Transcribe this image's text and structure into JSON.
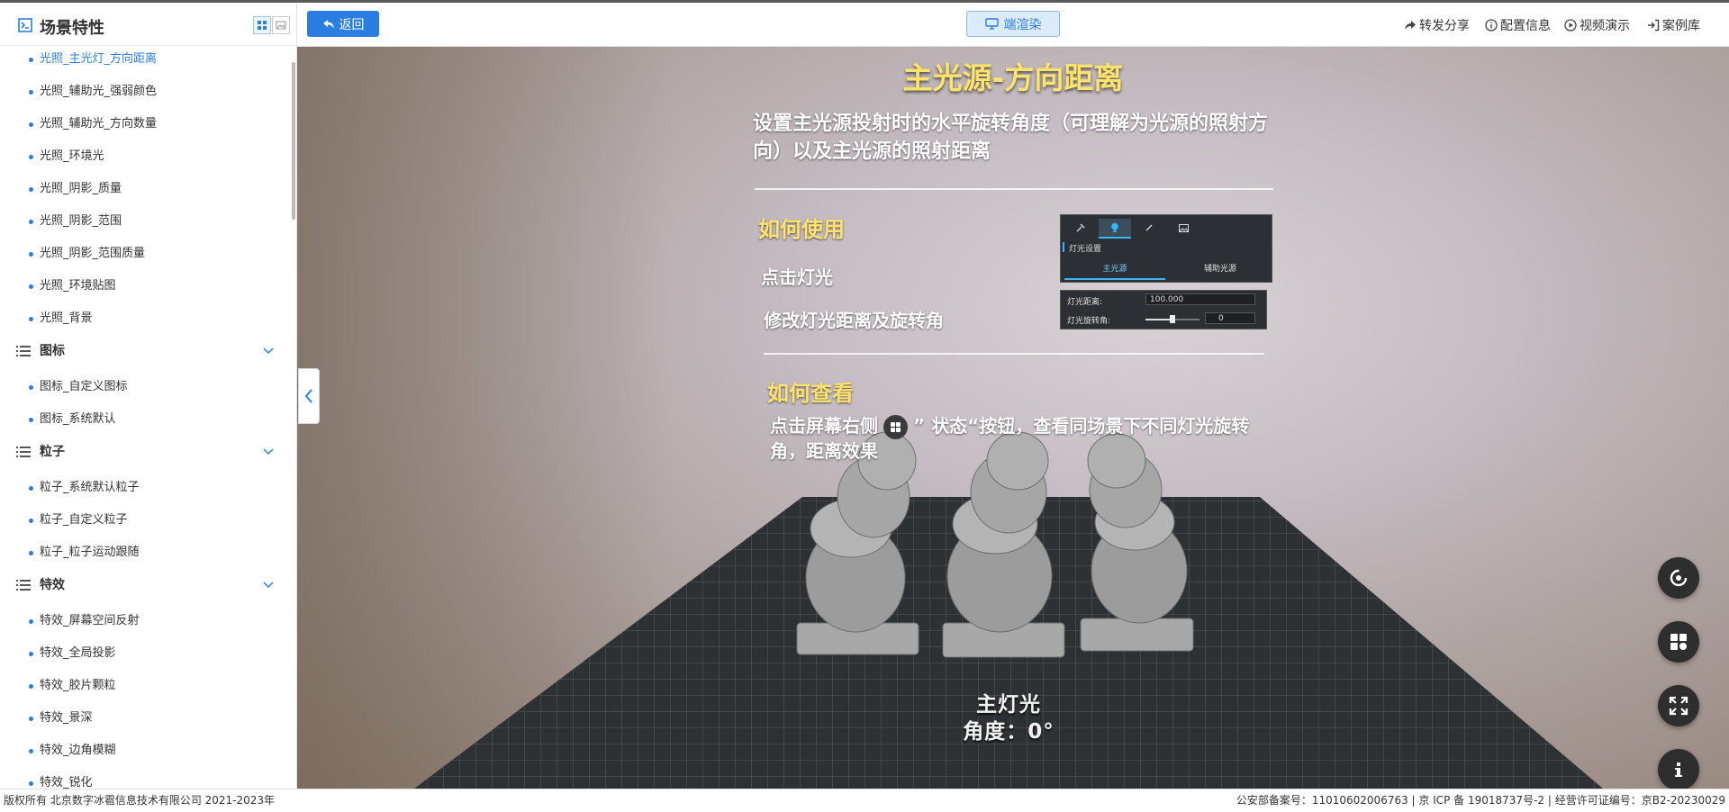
{
  "sidebar": {
    "title": "场景特性",
    "items_top": [
      {
        "label": "光照_主光灯_方向距离",
        "active": true
      },
      {
        "label": "光照_辅助光_强弱颜色"
      },
      {
        "label": "光照_辅助光_方向数量"
      },
      {
        "label": "光照_环境光"
      },
      {
        "label": "光照_阴影_质量"
      },
      {
        "label": "光照_阴影_范围"
      },
      {
        "label": "光照_阴影_范围质量"
      },
      {
        "label": "光照_环境贴图"
      },
      {
        "label": "光照_背景"
      }
    ],
    "groups": [
      {
        "label": "图标",
        "items": [
          "图标_自定义图标",
          "图标_系统默认"
        ]
      },
      {
        "label": "粒子",
        "items": [
          "粒子_系统默认粒子",
          "粒子_自定义粒子",
          "粒子_粒子运动跟随"
        ]
      },
      {
        "label": "特效",
        "items": [
          "特效_屏幕空间反射",
          "特效_全局投影",
          "特效_胶片颗粒",
          "特效_景深",
          "特效_边角模糊",
          "特效_锐化"
        ]
      }
    ]
  },
  "topbar": {
    "back_label": "返回",
    "render_label": "端渲染",
    "tools": [
      "转发分享",
      "配置信息",
      "视频演示",
      "案例库"
    ]
  },
  "viewport": {
    "title": "主光源-方向距离",
    "description": "设置主光源投射时的水平旋转角度（可理解为光源的照射方向）以及主光源的照射距离",
    "how_to_use": "如何使用",
    "step1": "点击灯光",
    "step2": "修改灯光距离及旋转角",
    "how_to_view": "如何查看",
    "view_text_a": "点击屏幕右侧",
    "view_text_b": "” 状态“按钮，查看同场景下不同灯光旋转角，距离效果",
    "panel": {
      "section": "灯光设置",
      "tab_main": "主光源",
      "tab_aux": "辅助光源",
      "distance_label": "灯光距离:",
      "distance_value": "100.000",
      "rotation_label": "灯光旋转角:",
      "rotation_value": "0",
      "slider_fraction": 0.5
    },
    "label_line1": "主灯光",
    "label_line2": "角度：0°"
  },
  "footer": {
    "left": "版权所有 北京数字冰雹信息技术有限公司 2021-2023年",
    "right": "公安部备案号：11010602006763 | 京 ICP 备 19018737号-2 | 经营许可证编号：京B2-20230029"
  },
  "colors": {
    "accent": "#2a7de1",
    "title_yellow": "#ffe36a"
  }
}
